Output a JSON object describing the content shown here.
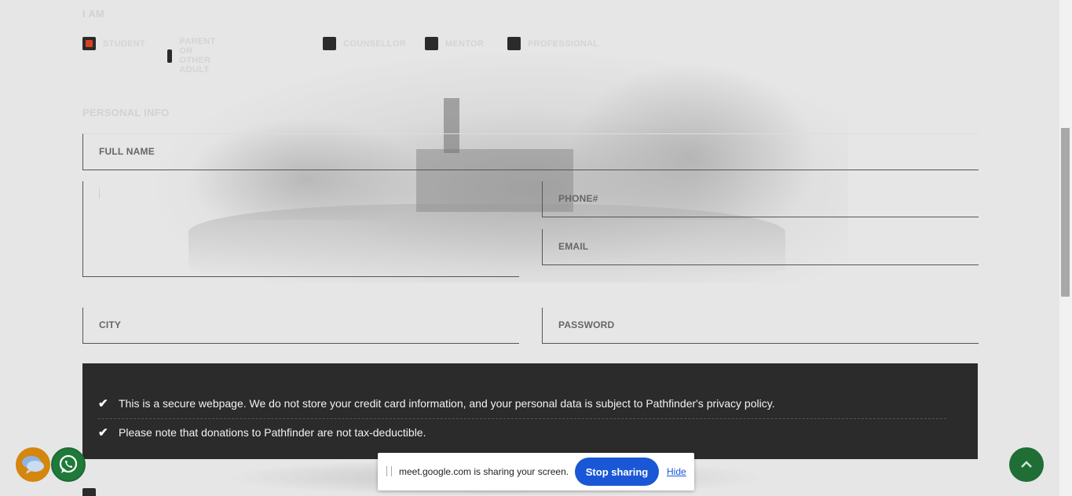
{
  "role_section": {
    "label": "I AM",
    "options": [
      {
        "label": "STUDENT",
        "checked": true
      },
      {
        "label": "PARENT OR OTHER ADULT",
        "checked": false
      },
      {
        "label": "COUNSELLOR",
        "checked": false
      },
      {
        "label": "MENTOR",
        "checked": false
      },
      {
        "label": "PROFESSIONAL",
        "checked": false
      }
    ]
  },
  "personal_info": {
    "label": "PERSONAL INFO",
    "full_name_label": "FULL NAME",
    "phone_label": "PHONE#",
    "email_label": "EMAIL",
    "city_label": "CITY",
    "password_label": "PASSWORD"
  },
  "notice": {
    "line1": "This is a secure webpage. We do not store your credit card information, and your personal data is subject to Pathfinder's privacy policy.",
    "line2": "Please note that donations to Pathfinder are not tax-deductible."
  },
  "share_bar": {
    "message": "meet.google.com is sharing your screen.",
    "stop_label": "Stop sharing",
    "hide_label": "Hide"
  },
  "colors": {
    "accent_checkbox": "#d9411e",
    "notice_bg": "#2b2b2b",
    "stop_button": "#1a57d6",
    "chat_button": "#d4860f",
    "whatsapp_button": "#1f7a3a",
    "top_button": "#1f6e35"
  }
}
